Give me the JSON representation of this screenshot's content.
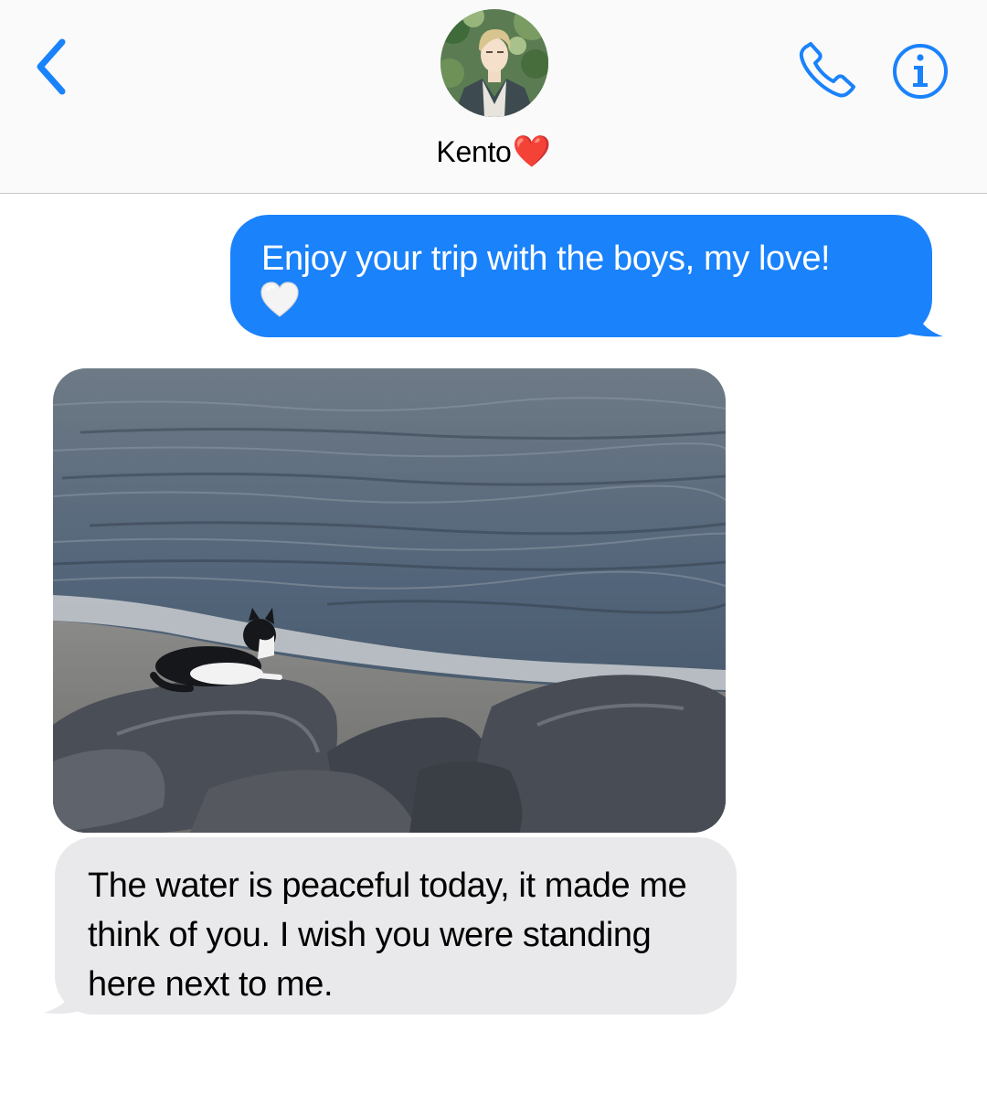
{
  "header": {
    "back_icon": "chevron-left-icon",
    "contact_name": "Kento",
    "contact_emoji": "❤️",
    "phone_icon": "phone-icon",
    "info_icon": "info-icon",
    "accent_color": "#1a82fb"
  },
  "messages": {
    "sent": {
      "text": "Enjoy your trip with the boys, my love!",
      "emoji": "🤍",
      "bubble_color": "#1a82fb"
    },
    "photo": {
      "alt_icon": "photo-attachment"
    },
    "received": {
      "text": "The water is peaceful today, it made me think of you. I wish you were standing here next to me.",
      "bubble_color": "#e9e9eb"
    }
  }
}
